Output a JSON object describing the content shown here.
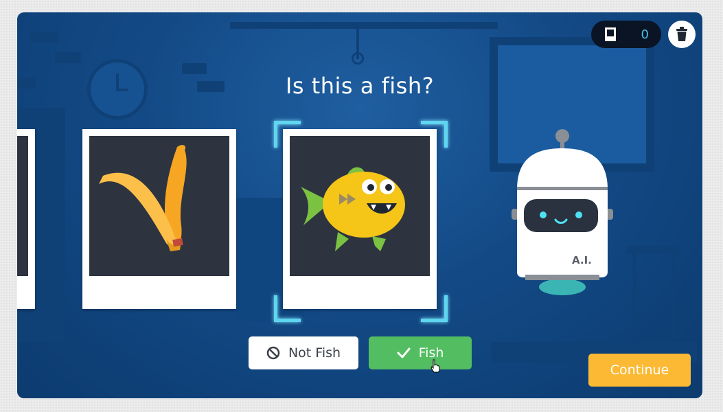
{
  "question": "Is this a fish?",
  "counter": {
    "value": "0",
    "icon": "book-icon"
  },
  "buttons": {
    "not_fish": "Not Fish",
    "fish": "Fish",
    "continue": "Continue"
  },
  "robot": {
    "label": "A.I."
  },
  "colors": {
    "background": "#134a86",
    "fish_button": "#52bd61",
    "continue_button": "#fbb934",
    "selection_bracket": "#5fd6ef"
  }
}
